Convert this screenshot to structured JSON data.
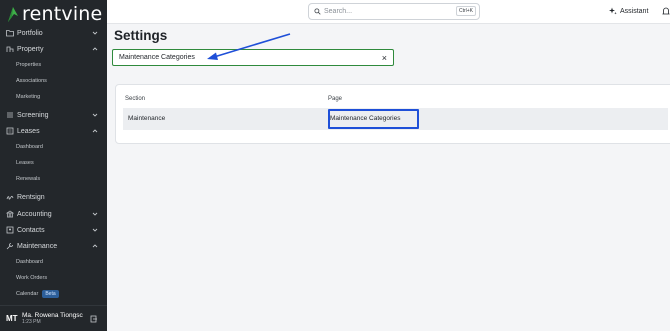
{
  "app": {
    "logo_text": "rentvine",
    "accent": "#2f8a3c",
    "sidebar_bg": "#23272b"
  },
  "sidebar": {
    "items": [
      {
        "label": "Portfolio",
        "icon": "folder-icon",
        "chevron": "down"
      },
      {
        "label": "Property",
        "icon": "building-icon",
        "chevron": "up"
      },
      {
        "label": "Screening",
        "icon": "list-icon",
        "chevron": "down"
      },
      {
        "label": "Leases",
        "icon": "document-icon",
        "chevron": "up"
      },
      {
        "label": "Rentsign",
        "icon": "signature-icon"
      },
      {
        "label": "Accounting",
        "icon": "bank-icon",
        "chevron": "down"
      },
      {
        "label": "Contacts",
        "icon": "contacts-icon",
        "chevron": "down"
      },
      {
        "label": "Maintenance",
        "icon": "wrench-icon",
        "chevron": "up"
      }
    ],
    "property_sub": [
      "Properties",
      "Associations",
      "Marketing"
    ],
    "leases_sub": [
      "Dashboard",
      "Leases",
      "Renewals"
    ],
    "maintenance_sub": [
      "Dashboard",
      "Work Orders",
      "Calendar"
    ],
    "beta_label": "Beta",
    "user": {
      "initials": "MT",
      "name": "Ma. Rowena Tiongsc",
      "time": "1:23 PM"
    }
  },
  "topbar": {
    "search_placeholder": "Search...",
    "search_shortcut": "Ctrl+K",
    "assistant_label": "Assistant"
  },
  "main": {
    "title": "Settings",
    "filter_value": "Maintenance Categories",
    "clear_symbol": "×",
    "table": {
      "headers": [
        "Section",
        "Page"
      ],
      "rows": [
        {
          "section": "Maintenance",
          "page": "Maintenance Categories"
        }
      ]
    },
    "annotation_color": "#1e4fd8"
  }
}
